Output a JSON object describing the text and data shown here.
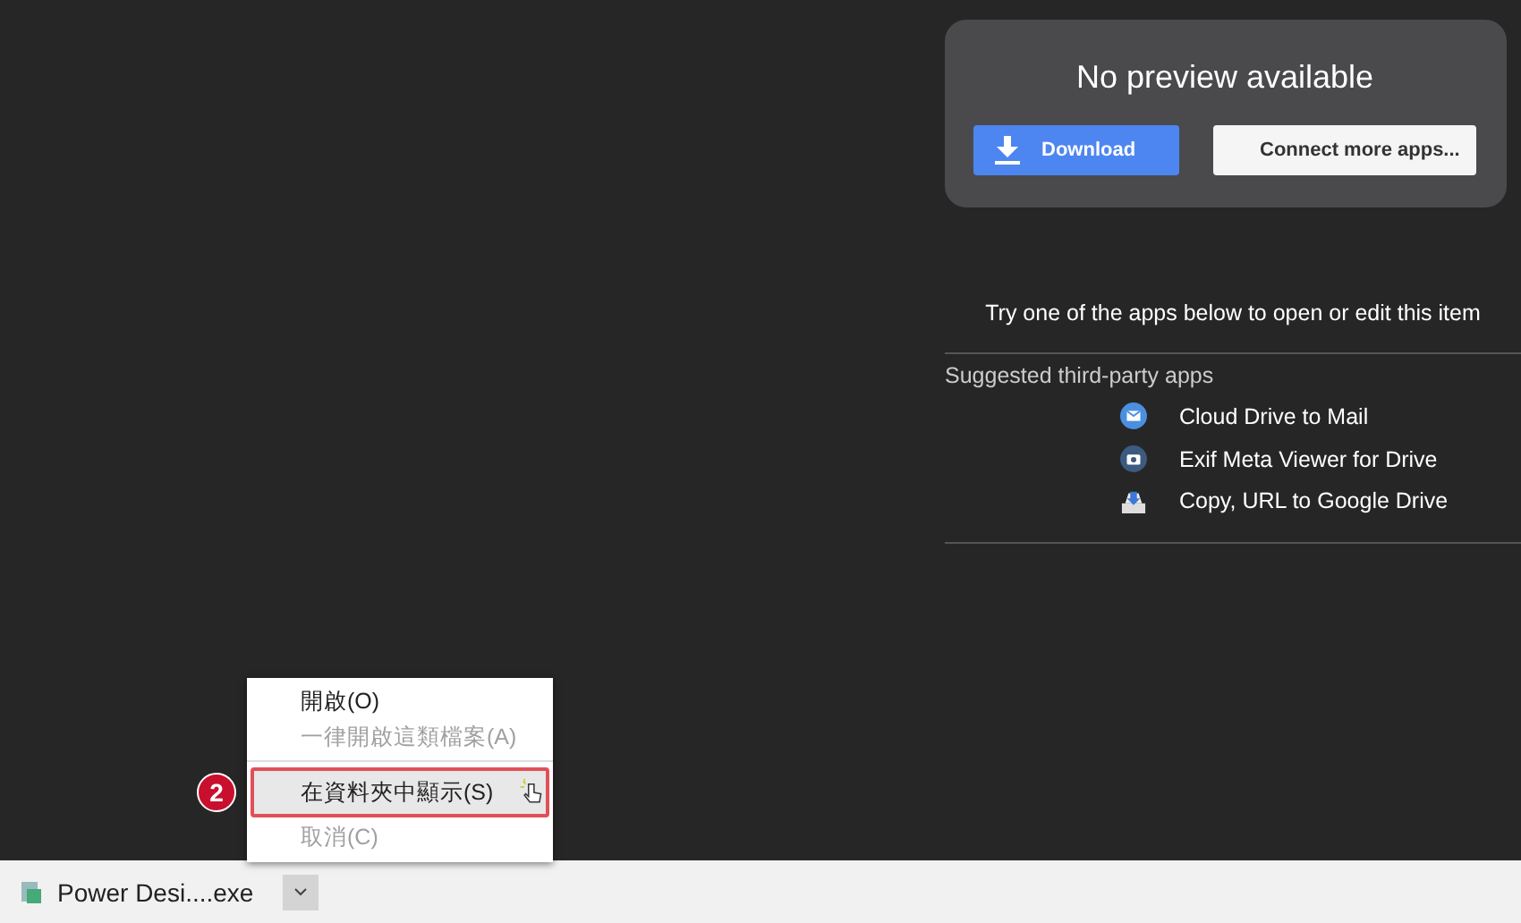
{
  "preview": {
    "title": "No preview available",
    "download_button": "Download",
    "connect_button": "Connect more apps..."
  },
  "apps": {
    "prompt": "Try one of the apps below to open or edit this item",
    "heading": "Suggested third-party apps",
    "items": [
      {
        "kind": "mail",
        "label": "Cloud Drive to Mail"
      },
      {
        "kind": "camera",
        "label": "Exif Meta Viewer for Drive"
      },
      {
        "kind": "copy",
        "label": "Copy, URL to Google Drive"
      }
    ]
  },
  "context_menu": {
    "items": [
      {
        "label": "開啟(O)",
        "disabled": false,
        "selected": false
      },
      {
        "label": "一律開啟這類檔案(A)",
        "disabled": true,
        "selected": false
      },
      {
        "label": "在資料夾中顯示(S)",
        "disabled": false,
        "selected": true
      },
      {
        "label": "取消(C)",
        "disabled": true,
        "selected": false
      }
    ]
  },
  "step_badge": "2",
  "download_bar": {
    "file_name": "Power Desi....exe"
  }
}
